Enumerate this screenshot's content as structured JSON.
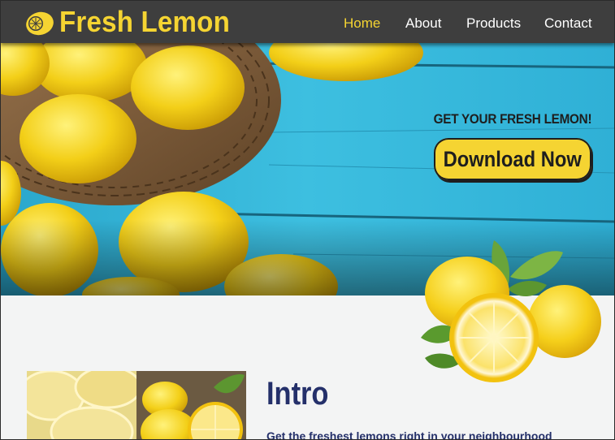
{
  "header": {
    "logo_text": "Fresh Lemon",
    "logo_icon": "lemon-slice-icon",
    "nav": [
      {
        "label": "Home",
        "active": true
      },
      {
        "label": "About",
        "active": false
      },
      {
        "label": "Products",
        "active": false
      },
      {
        "label": "Contact",
        "active": false
      }
    ]
  },
  "hero": {
    "tagline": "GET YOUR FRESH LEMON!",
    "cta_label": "Download Now"
  },
  "intro": {
    "title": "Intro",
    "subtitle": "Get the freshest lemons right in your neighbourhood"
  },
  "colors": {
    "header_bg": "#3e3e3e",
    "accent_yellow": "#f5d432",
    "wood_blue": "#33b6d8",
    "intro_navy": "#24306a",
    "page_bg": "#f3f4f4"
  }
}
